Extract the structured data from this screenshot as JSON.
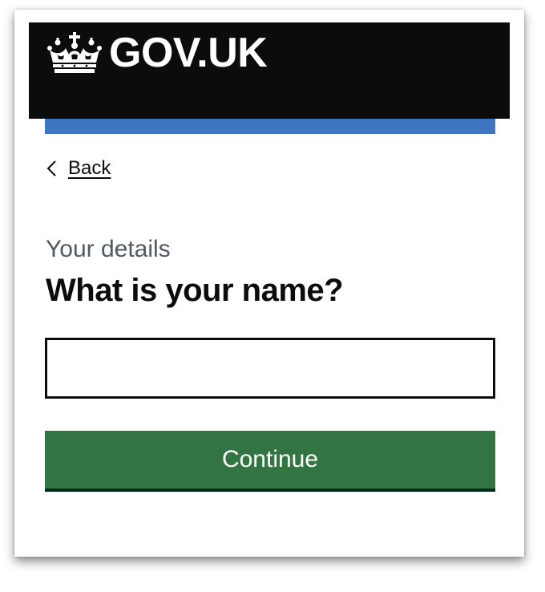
{
  "header": {
    "logo_text": "GOV.UK",
    "logo_icon": "crown-icon",
    "background_color": "#0b0c0c",
    "accent_bar_color": "#3f74c0"
  },
  "navigation": {
    "back_label": "Back",
    "back_icon": "chevron-left-icon"
  },
  "form": {
    "caption": "Your details",
    "heading": "What is your name?",
    "name_input": {
      "value": "",
      "placeholder": ""
    },
    "continue_label": "Continue",
    "button_color": "#327543"
  }
}
